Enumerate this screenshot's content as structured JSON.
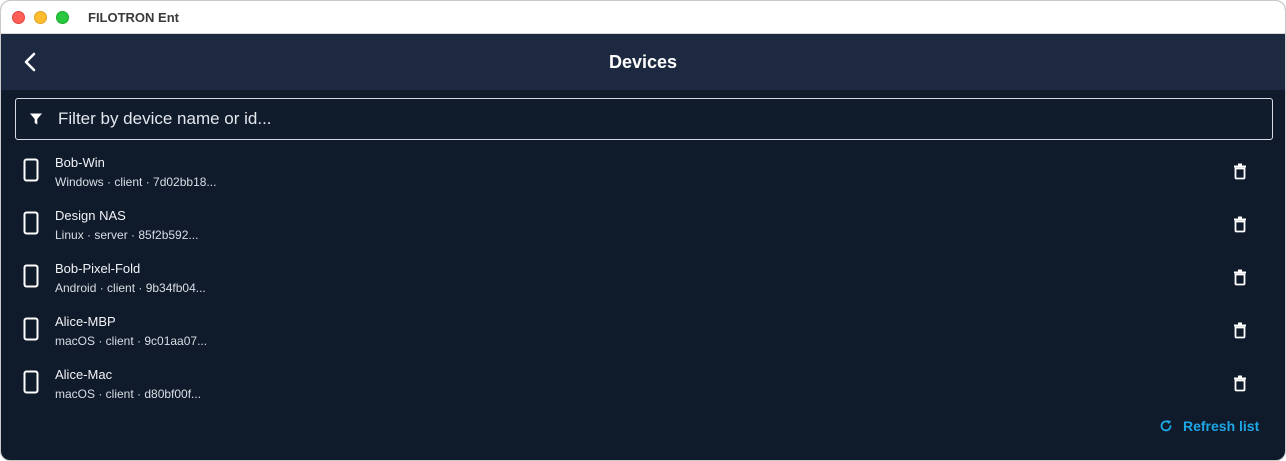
{
  "window": {
    "title": "FILOTRON Ent"
  },
  "header": {
    "title": "Devices"
  },
  "filter": {
    "placeholder": "Filter by device name or id..."
  },
  "devices": [
    {
      "name": "Bob-Win",
      "meta": "Windows · client · 7d02bb18..."
    },
    {
      "name": "Design NAS",
      "meta": "Linux · server · 85f2b592..."
    },
    {
      "name": "Bob-Pixel-Fold",
      "meta": "Android · client · 9b34fb04..."
    },
    {
      "name": "Alice-MBP",
      "meta": "macOS · client · 9c01aa07..."
    },
    {
      "name": "Alice-Mac",
      "meta": "macOS · client · d80bf00f..."
    }
  ],
  "footer": {
    "refresh_label": "Refresh list"
  },
  "icons": {
    "back": "chevron-left-icon",
    "filter": "filter-icon",
    "device": "phone-icon",
    "delete": "trash-icon",
    "refresh": "refresh-icon"
  },
  "colors": {
    "background": "#0f1a2a",
    "header": "#1d2940",
    "accent": "#1ea7e6"
  }
}
